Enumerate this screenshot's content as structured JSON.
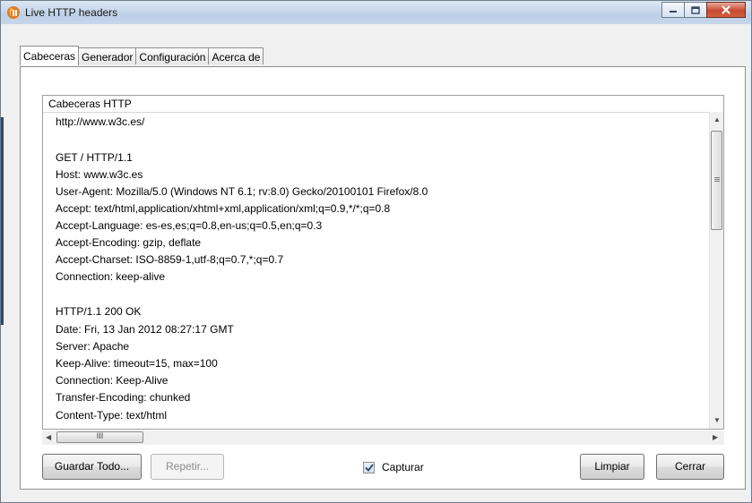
{
  "window": {
    "title": "Live HTTP headers",
    "minimize_icon": "minimize-icon",
    "maximize_icon": "maximize-icon",
    "close_icon": "close-icon"
  },
  "tabs": [
    {
      "label": "Cabeceras",
      "active": true
    },
    {
      "label": "Generador",
      "active": false
    },
    {
      "label": "Configuración",
      "active": false
    },
    {
      "label": "Acerca de",
      "active": false
    }
  ],
  "headers_group": {
    "title": "Cabeceras HTTP",
    "lines": [
      "http://www.w3c.es/",
      "",
      "GET / HTTP/1.1",
      "Host: www.w3c.es",
      "User-Agent: Mozilla/5.0 (Windows NT 6.1; rv:8.0) Gecko/20100101 Firefox/8.0",
      "Accept: text/html,application/xhtml+xml,application/xml;q=0.9,*/*;q=0.8",
      "Accept-Language: es-es,es;q=0.8,en-us;q=0.5,en;q=0.3",
      "Accept-Encoding: gzip, deflate",
      "Accept-Charset: ISO-8859-1,utf-8;q=0.7,*;q=0.7",
      "Connection: keep-alive",
      "",
      "HTTP/1.1 200 OK",
      "Date: Fri, 13 Jan 2012 08:27:17 GMT",
      "Server: Apache",
      "Keep-Alive: timeout=15, max=100",
      "Connection: Keep-Alive",
      "Transfer-Encoding: chunked",
      "Content-Type: text/html"
    ]
  },
  "hscroll": {
    "thumb_glyph": "III"
  },
  "buttons": {
    "save_all": "Guardar Todo...",
    "repeat": "Repetir...",
    "capture_label": "Capturar",
    "capture_checked": true,
    "clear": "Limpiar",
    "close": "Cerrar"
  }
}
